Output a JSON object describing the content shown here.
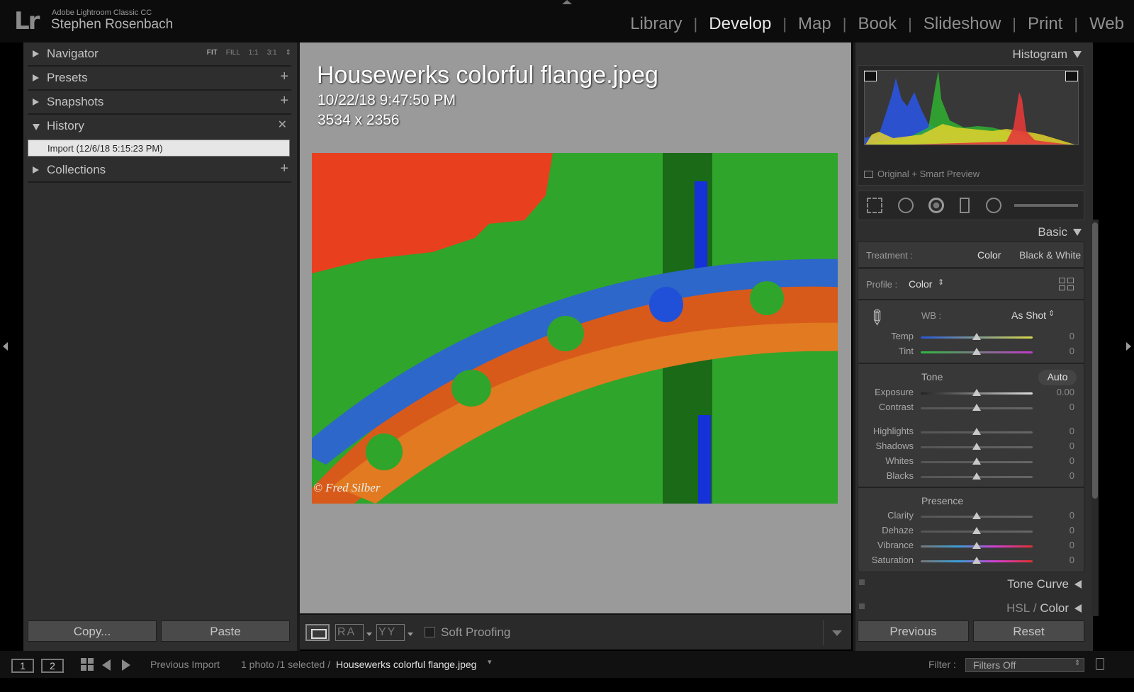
{
  "identity": {
    "app_name": "Adobe Lightroom Classic CC",
    "user": "Stephen Rosenbach",
    "logo": "Lr"
  },
  "modules": [
    "Library",
    "Develop",
    "Map",
    "Book",
    "Slideshow",
    "Print",
    "Web"
  ],
  "active_module": "Develop",
  "left_panel": {
    "navigator": {
      "label": "Navigator",
      "zoom": [
        "FIT",
        "FILL",
        "1:1",
        "3:1"
      ]
    },
    "presets": {
      "label": "Presets"
    },
    "snapshots": {
      "label": "Snapshots"
    },
    "history": {
      "label": "History",
      "items": [
        "Import (12/6/18 5:15:23 PM)"
      ]
    },
    "collections": {
      "label": "Collections"
    },
    "copy_label": "Copy...",
    "paste_label": "Paste"
  },
  "photo_info": {
    "filename": "Housewerks colorful flange.jpeg",
    "datetime": "10/22/18 9:47:50 PM",
    "dimensions": "3534 x 2356",
    "watermark": "© Fred Silber"
  },
  "toolbar": {
    "ab_label": "RA",
    "yy_label": "YY",
    "soft_proofing": "Soft Proofing"
  },
  "right_panel": {
    "histogram_label": "Histogram",
    "preview_status": "Original + Smart Preview",
    "basic_label": "Basic",
    "treatment_label": "Treatment :",
    "treatment_color": "Color",
    "treatment_bw": "Black & White",
    "profile_label": "Profile :",
    "profile_value": "Color",
    "wb_label": "WB :",
    "wb_value": "As Shot",
    "tone_label": "Tone",
    "auto_label": "Auto",
    "presence_label": "Presence",
    "sliders": {
      "temp": {
        "label": "Temp",
        "value": "0"
      },
      "tint": {
        "label": "Tint",
        "value": "0"
      },
      "exposure": {
        "label": "Exposure",
        "value": "0.00"
      },
      "contrast": {
        "label": "Contrast",
        "value": "0"
      },
      "highlights": {
        "label": "Highlights",
        "value": "0"
      },
      "shadows": {
        "label": "Shadows",
        "value": "0"
      },
      "whites": {
        "label": "Whites",
        "value": "0"
      },
      "blacks": {
        "label": "Blacks",
        "value": "0"
      },
      "clarity": {
        "label": "Clarity",
        "value": "0"
      },
      "dehaze": {
        "label": "Dehaze",
        "value": "0"
      },
      "vibrance": {
        "label": "Vibrance",
        "value": "0"
      },
      "saturation": {
        "label": "Saturation",
        "value": "0"
      }
    },
    "tone_curve_label": "Tone Curve",
    "hsl_label": "HSL",
    "hsl_sep": " / ",
    "color_label": "Color",
    "previous_label": "Previous",
    "reset_label": "Reset"
  },
  "filmstrip": {
    "screen1": "1",
    "screen2": "2",
    "source": "Previous Import",
    "count": "1 photo /1 selected /",
    "selected_file": "Housewerks colorful flange.jpeg",
    "filter_label": "Filter :",
    "filter_value": "Filters Off"
  },
  "colors": {
    "background": "#000000",
    "panel": "#2e2e2e",
    "center_bg": "#9a9a9a",
    "active_text": "#e8e8e8"
  }
}
